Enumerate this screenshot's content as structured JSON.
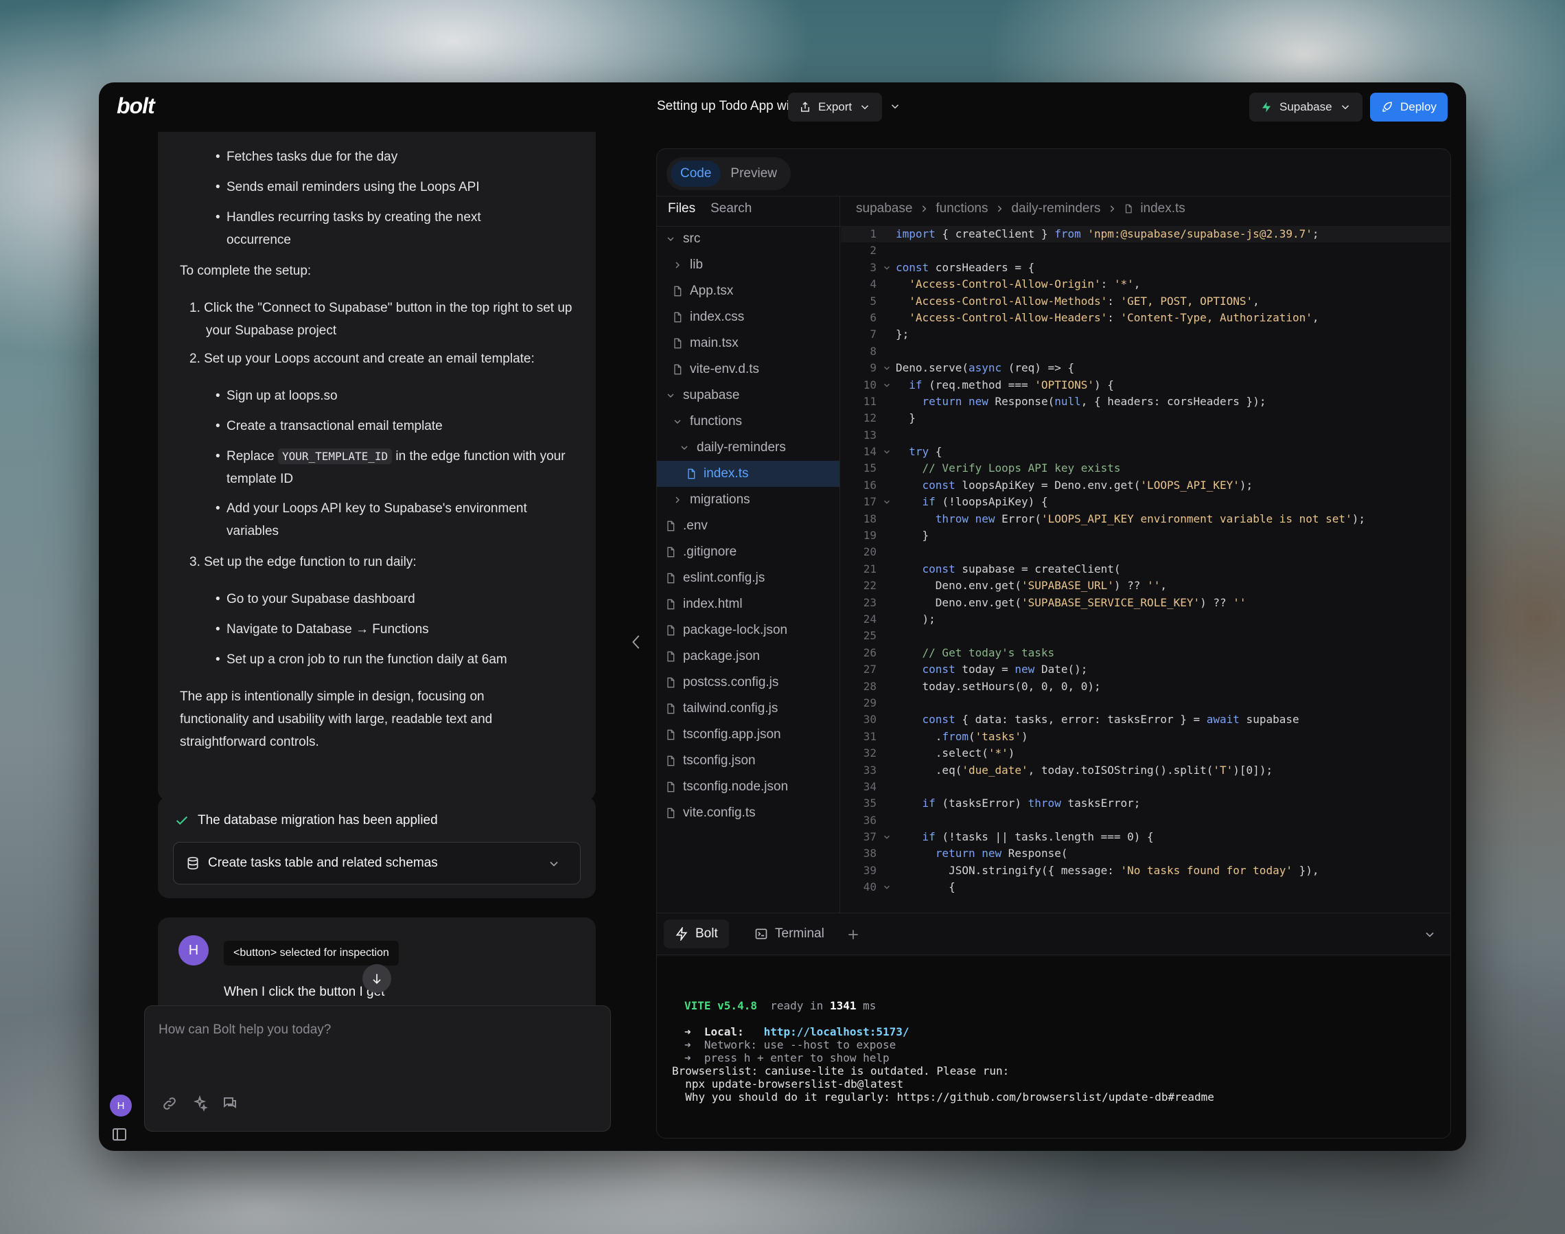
{
  "app": {
    "logo": "bolt",
    "title": "Setting up Todo App with Supabase"
  },
  "toolbar": {
    "export_label": "Export",
    "supabase_label": "Supabase",
    "deploy_label": "Deploy"
  },
  "chat": {
    "bullets_a": [
      "Fetches tasks due for the day",
      "Sends email reminders using the Loops API",
      "Handles recurring tasks by creating the next occurrence"
    ],
    "setup_intro": "To complete the setup:",
    "step1": "1. Click the \"Connect to Supabase\" button in the top right to set up your Supabase project",
    "step2": "2. Set up your Loops account and create an email template:",
    "step2_bullets": [
      "Sign up at loops.so",
      "Create a transactional email template"
    ],
    "replace_pre": "Replace ",
    "replace_code": "YOUR_TEMPLATE_ID",
    "replace_post": " in the edge function with your template ID",
    "step2_last": "Add your Loops API key to Supabase's environment variables",
    "step3": "3. Set up the edge function to run daily:",
    "step3_bullets": [
      "Go to your Supabase dashboard",
      "Navigate to Database → Functions",
      "Set up a cron job to run the function daily at 6am"
    ],
    "closing": "The app is intentionally simple in design, focusing on functionality and usability with large, readable text and straightforward controls.",
    "migration_title": "The database migration has been applied",
    "migration_item": "Create tasks table and related schemas",
    "user_initial": "H",
    "inspection_badge": "<button> selected for inspection",
    "user_message": "When I click the button I get",
    "input_placeholder": "How can Bolt help you today?"
  },
  "workbench": {
    "tabs": [
      "Code",
      "Preview"
    ],
    "files_tabs": [
      "Files",
      "Search"
    ],
    "breadcrumb": [
      "supabase",
      "functions",
      "daily-reminders",
      "index.ts"
    ],
    "tree": [
      {
        "name": "src",
        "type": "folder-open",
        "depth": 0
      },
      {
        "name": "lib",
        "type": "folder-closed",
        "depth": 1
      },
      {
        "name": "App.tsx",
        "type": "file",
        "depth": 1
      },
      {
        "name": "index.css",
        "type": "file",
        "depth": 1
      },
      {
        "name": "main.tsx",
        "type": "file",
        "depth": 1
      },
      {
        "name": "vite-env.d.ts",
        "type": "file",
        "depth": 1
      },
      {
        "name": "supabase",
        "type": "folder-open",
        "depth": 0
      },
      {
        "name": "functions",
        "type": "folder-open",
        "depth": 1
      },
      {
        "name": "daily-reminders",
        "type": "folder-open",
        "depth": 2
      },
      {
        "name": "index.ts",
        "type": "file",
        "depth": 3,
        "selected": true
      },
      {
        "name": "migrations",
        "type": "folder-closed",
        "depth": 1
      },
      {
        "name": ".env",
        "type": "file",
        "depth": 0
      },
      {
        "name": ".gitignore",
        "type": "file",
        "depth": 0
      },
      {
        "name": "eslint.config.js",
        "type": "file",
        "depth": 0
      },
      {
        "name": "index.html",
        "type": "file",
        "depth": 0
      },
      {
        "name": "package-lock.json",
        "type": "file",
        "depth": 0
      },
      {
        "name": "package.json",
        "type": "file",
        "depth": 0
      },
      {
        "name": "postcss.config.js",
        "type": "file",
        "depth": 0
      },
      {
        "name": "tailwind.config.js",
        "type": "file",
        "depth": 0
      },
      {
        "name": "tsconfig.app.json",
        "type": "file",
        "depth": 0
      },
      {
        "name": "tsconfig.json",
        "type": "file",
        "depth": 0
      },
      {
        "name": "tsconfig.node.json",
        "type": "file",
        "depth": 0
      },
      {
        "name": "vite.config.ts",
        "type": "file",
        "depth": 0
      }
    ],
    "code_lines": [
      "import { createClient } from 'npm:@supabase/supabase-js@2.39.7';",
      "",
      "const corsHeaders = {",
      "  'Access-Control-Allow-Origin': '*',",
      "  'Access-Control-Allow-Methods': 'GET, POST, OPTIONS',",
      "  'Access-Control-Allow-Headers': 'Content-Type, Authorization',",
      "};",
      "",
      "Deno.serve(async (req) => {",
      "  if (req.method === 'OPTIONS') {",
      "    return new Response(null, { headers: corsHeaders });",
      "  }",
      "",
      "  try {",
      "    // Verify Loops API key exists",
      "    const loopsApiKey = Deno.env.get('LOOPS_API_KEY');",
      "    if (!loopsApiKey) {",
      "      throw new Error('LOOPS_API_KEY environment variable is not set');",
      "    }",
      "",
      "    const supabase = createClient(",
      "      Deno.env.get('SUPABASE_URL') ?? '',",
      "      Deno.env.get('SUPABASE_SERVICE_ROLE_KEY') ?? ''",
      "    );",
      "",
      "    // Get today's tasks",
      "    const today = new Date();",
      "    today.setHours(0, 0, 0, 0);",
      "",
      "    const { data: tasks, error: tasksError } = await supabase",
      "      .from('tasks')",
      "      .select('*')",
      "      .eq('due_date', today.toISOString().split('T')[0]);",
      "",
      "    if (tasksError) throw tasksError;",
      "",
      "    if (!tasks || tasks.length === 0) {",
      "      return new Response(",
      "        JSON.stringify({ message: 'No tasks found for today' }),",
      "        {"
    ],
    "fold_lines": [
      3,
      9,
      10,
      14,
      17,
      37,
      40
    ],
    "bottom_tabs": [
      "Bolt",
      "Terminal"
    ],
    "terminal": {
      "vite": "VITE v5.4.8",
      "ready_pre": "  ready in ",
      "ready_ms": "1341",
      "ready_post": " ms",
      "local_label": "➜  Local:   ",
      "local_url": "http://localhost:5173/",
      "network_line": "➜  Network: use --host to expose",
      "help_line": "➜  press h + enter to show help",
      "browserslist": "Browserslist: caniuse-lite is outdated. Please run:",
      "npx": "  npx update-browserslist-db@latest",
      "why": "  Why you should do it regularly: https://github.com/browserslist/update-db#readme"
    }
  },
  "colors": {
    "accent": "#2b7bf0",
    "selected": "#5aa2ff",
    "avatar": "#7c5cd6",
    "keyword": "#7aa2f7",
    "string": "#e9c48b",
    "comment": "#8ab68a",
    "vite_green": "#4ade80"
  }
}
